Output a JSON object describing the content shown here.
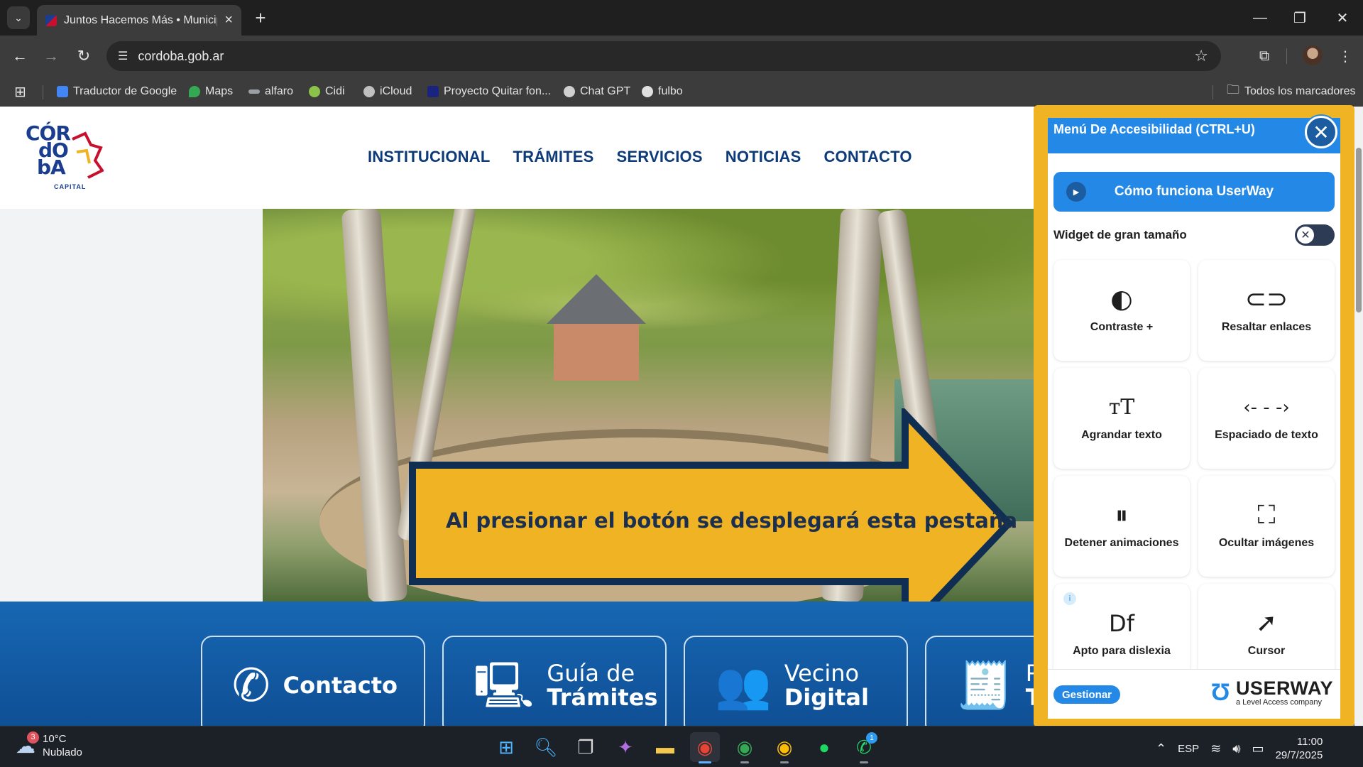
{
  "browser": {
    "tab_title": "Juntos Hacemos Más • Municip",
    "url": "cordoba.gob.ar",
    "bookmarks": [
      {
        "label": "Traductor de Google",
        "icon": "google-translate-icon",
        "color": "#4285f4"
      },
      {
        "label": "Maps",
        "icon": "maps-pin-icon",
        "color": "#34a853"
      },
      {
        "label": "alfaro",
        "icon": "bookmark-icon",
        "color": "#9aa0a6"
      },
      {
        "label": "Cidi",
        "icon": "cidi-icon",
        "color": "#8bc34a"
      },
      {
        "label": "iCloud",
        "icon": "apple-icon",
        "color": "#c0c0c0"
      },
      {
        "label": "Proyecto Quitar fon...",
        "icon": "drive-icon",
        "color": "#1a237e"
      },
      {
        "label": "Chat GPT",
        "icon": "openai-icon",
        "color": "#d0d0d0"
      },
      {
        "label": "fulbo",
        "icon": "soccer-ball-icon",
        "color": "#e0e0e0"
      }
    ],
    "all_bookmarks": "Todos los marcadores"
  },
  "site": {
    "logo_lines": [
      "CÓR",
      "dO",
      "bA"
    ],
    "logo_sub": "CAPITAL",
    "nav": [
      "INSTITUCIONAL",
      "TRÁMITES",
      "SERVICIOS",
      "NOTICIAS",
      "CONTACTO"
    ],
    "callout": "Al presionar el botón se desplegará esta pestaña",
    "quick_links": [
      {
        "lines": [
          "Contacto"
        ],
        "icon": "phone-icon"
      },
      {
        "lines": [
          "Guía de",
          "Trámites"
        ],
        "icon": "monitor-search-icon"
      },
      {
        "lines": [
          "Vecino",
          "Digital"
        ],
        "icon": "people-icon"
      },
      {
        "lines": [
          "Po",
          "Tr"
        ],
        "icon": "receipt-icon"
      }
    ],
    "colors": {
      "brand_blue": "#0d3a78",
      "band_blue": "#1767b3",
      "callout_fill": "#f0b323",
      "callout_border": "#0f2e52"
    }
  },
  "widget": {
    "title": "Menú De Accesibilidad (CTRL+U)",
    "howto": "Cómo funciona UserWay",
    "large_widget_label": "Widget de gran tamaño",
    "large_widget_on": false,
    "options": [
      {
        "label": "Contraste +",
        "icon": "contrast-icon"
      },
      {
        "label": "Resaltar enlaces",
        "icon": "link-icon"
      },
      {
        "label": "Agrandar texto",
        "icon": "text-size-icon"
      },
      {
        "label": "Espaciado de texto",
        "icon": "text-spacing-icon"
      },
      {
        "label": "Detener animaciones",
        "icon": "pause-animation-icon"
      },
      {
        "label": "Ocultar imágenes",
        "icon": "hide-image-icon"
      },
      {
        "label": "Apto para dislexia",
        "icon": "dyslexia-font-icon"
      },
      {
        "label": "Cursor",
        "icon": "cursor-icon"
      }
    ],
    "manage": "Gestionar",
    "brand_name": "USERWAY",
    "brand_sub": "a Level Access company",
    "colors": {
      "accent": "#2488e6",
      "frame": "#f0b323"
    }
  },
  "taskbar": {
    "weather_temp": "10°C",
    "weather_desc": "Nublado",
    "weather_badge": "3",
    "apps": [
      {
        "name": "start-button",
        "icon": "windows-icon"
      },
      {
        "name": "search-button",
        "icon": "search-icon"
      },
      {
        "name": "task-view-button",
        "icon": "task-view-icon"
      },
      {
        "name": "copilot-button",
        "icon": "copilot-icon"
      },
      {
        "name": "file-explorer-button",
        "icon": "folder-icon"
      },
      {
        "name": "chrome-button",
        "icon": "chrome-icon",
        "active": true
      },
      {
        "name": "chrome-profile-2-button",
        "icon": "chrome-icon"
      },
      {
        "name": "chrome-profile-3-button",
        "icon": "chrome-icon"
      },
      {
        "name": "spotify-button",
        "icon": "spotify-icon"
      },
      {
        "name": "whatsapp-button",
        "icon": "whatsapp-icon",
        "badge": "1"
      }
    ],
    "language": "ESP",
    "time": "11:00",
    "date": "29/7/2025"
  }
}
